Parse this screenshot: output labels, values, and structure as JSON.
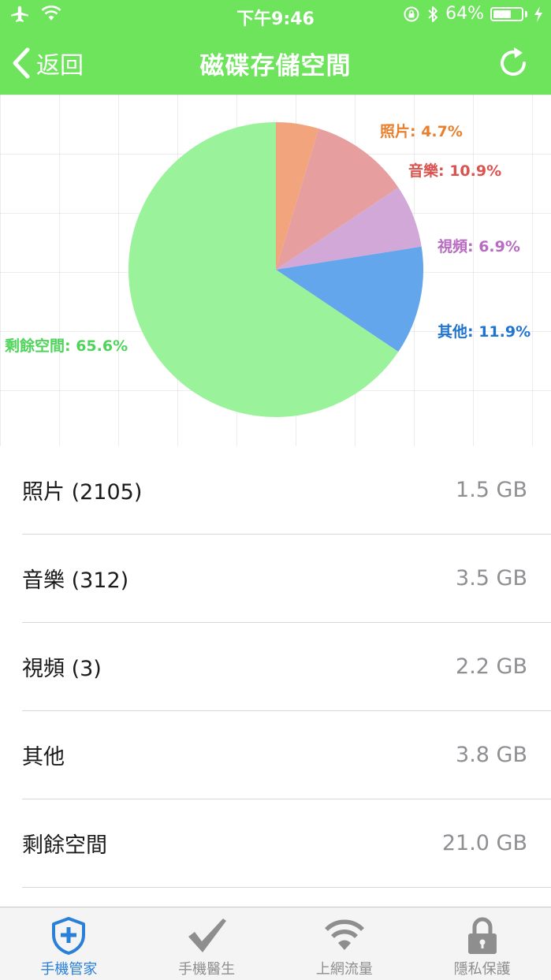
{
  "status_bar": {
    "time": "下午9:46",
    "battery_text": "64%",
    "battery_level": 0.64
  },
  "nav": {
    "back_label": "返回",
    "title": "磁碟存儲空間"
  },
  "colors": {
    "green": "#6ee35c",
    "photo": "#f2a57c",
    "music": "#e69e9e",
    "video": "#d2a8d8",
    "other": "#63a6ec",
    "free": "#9af29a",
    "photo_label": "#e8802f",
    "music_label": "#d9534f",
    "video_label": "#b86cc1",
    "other_label": "#1e74d0",
    "free_label": "#4fd45b",
    "tab_active": "#2a7fd8"
  },
  "chart_data": {
    "type": "pie",
    "slices": [
      {
        "label": "照片: 4.7%",
        "value": 4.7,
        "color": "#f2a57c",
        "label_color": "#e8802f"
      },
      {
        "label": "音樂: 10.9%",
        "value": 10.9,
        "color": "#e69e9e",
        "label_color": "#d9534f"
      },
      {
        "label": "視頻: 6.9%",
        "value": 6.9,
        "color": "#d2a8d8",
        "label_color": "#b86cc1"
      },
      {
        "label": "其他: 11.9%",
        "value": 11.9,
        "color": "#63a6ec",
        "label_color": "#1e74d0"
      },
      {
        "label": "剩餘空間: 65.6%",
        "value": 65.6,
        "color": "#9af29a",
        "label_color": "#4fd45b"
      }
    ]
  },
  "storage_list": [
    {
      "name": "照片 (2105)",
      "size": "1.5 GB"
    },
    {
      "name": "音樂 (312)",
      "size": "3.5 GB"
    },
    {
      "name": "視頻 (3)",
      "size": "2.2 GB"
    },
    {
      "name": "其他",
      "size": "3.8 GB"
    },
    {
      "name": "剩餘空間",
      "size": "21.0 GB"
    }
  ],
  "tabs": [
    {
      "label": "手機管家",
      "icon": "shield-plus-icon",
      "active": true
    },
    {
      "label": "手機醫生",
      "icon": "checkmark-icon",
      "active": false
    },
    {
      "label": "上網流量",
      "icon": "wifi-icon",
      "active": false
    },
    {
      "label": "隱私保護",
      "icon": "lock-icon",
      "active": false
    }
  ]
}
